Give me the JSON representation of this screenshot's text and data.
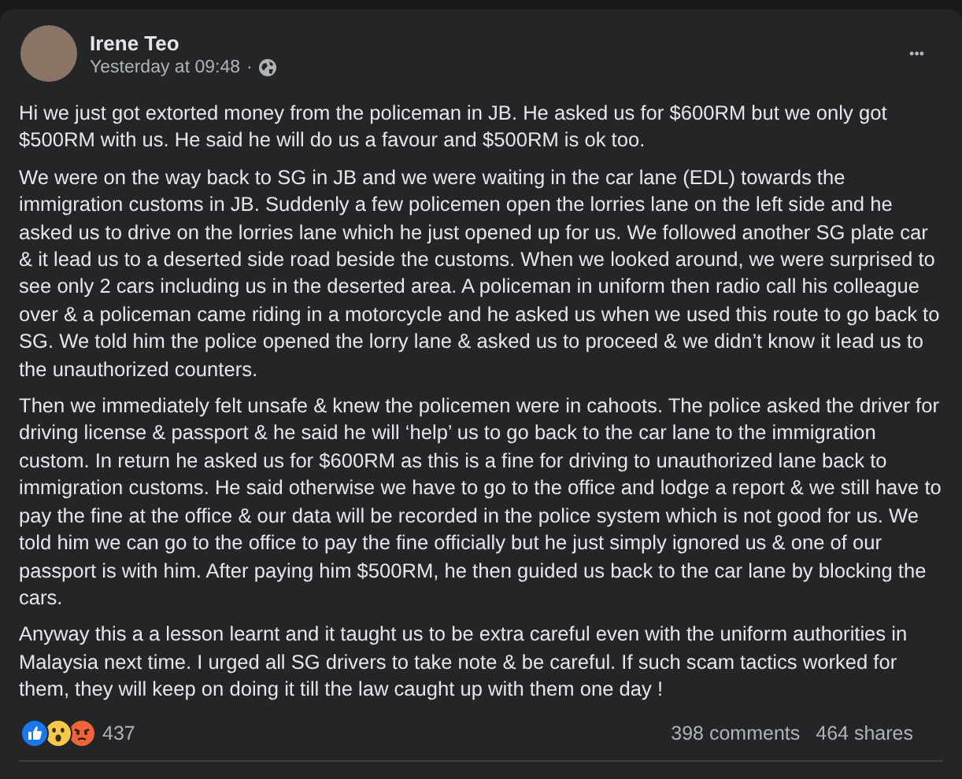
{
  "post": {
    "author": "Irene Teo",
    "time": "Yesterday at 09:48",
    "separator": "·",
    "more": "•••",
    "paragraphs": [
      "Hi we just got extorted money from the policeman in JB. He asked us for $600RM but we only got $500RM with us. He said he will do us a favour and $500RM is ok too.",
      "We were on the way back to SG in JB and we were waiting in the car lane (EDL) towards the immigration customs in JB. Suddenly a few policemen open the lorries lane on the left side and he asked us to drive on the lorries lane which he just opened up for us. We followed another SG plate car & it lead us to a deserted side road beside the customs. When we looked around, we were surprised to see only 2 cars including us in the deserted area. A policeman in uniform then radio call his colleague over & a policeman came riding in a motorcycle and he asked us when we used this route to go back to SG. We told him the police opened the lorry lane & asked us to proceed & we didn’t know it lead us to the unauthorized counters.",
      "Then we immediately felt unsafe & knew the policemen were in cahoots. The police asked the driver for driving license & passport & he said he will ‘help’ us to go back to the car lane to the immigration custom. In return he asked us for $600RM as this is a fine for driving to unauthorized lane back to immigration customs. He said otherwise we have to go to the office and lodge a report & we still have to pay the fine at the office & our data will be recorded in the police system which is not good for us. We told him we can go to the office to pay the fine officially but he just simply ignored us & one of our passport is with him. After paying him $500RM, he then guided us back to the car lane by blocking the cars.",
      "Anyway this a a lesson learnt and it taught us to be extra careful even with the uniform authorities in Malaysia next time. I urged all SG drivers to take note & be careful. If such scam tactics worked for them, they will keep on doing it till the law caught up with them one day !"
    ],
    "reactions": {
      "count": "437",
      "items": [
        {
          "kind": "like"
        },
        {
          "kind": "wow"
        },
        {
          "kind": "angry"
        }
      ]
    },
    "comments": "398 comments",
    "shares": "464 shares"
  }
}
